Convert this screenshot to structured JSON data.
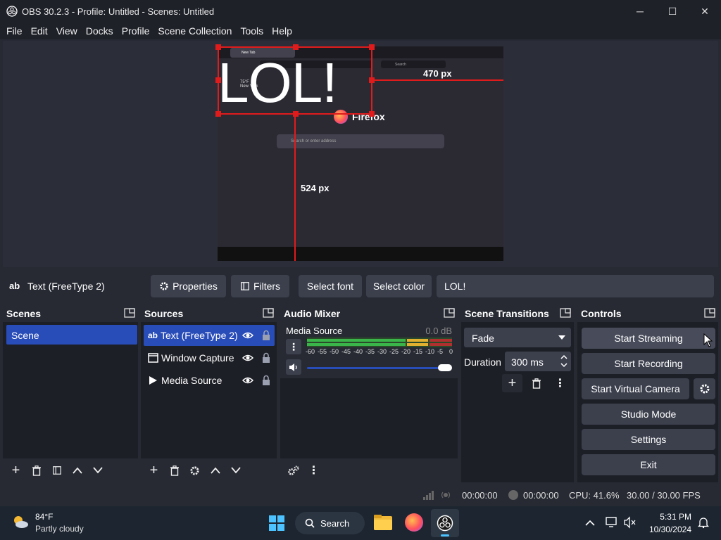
{
  "window": {
    "title": "OBS 30.2.3 - Profile: Untitled - Scenes: Untitled",
    "minimize": "─",
    "maximize": "☐",
    "close": "✕"
  },
  "menu": [
    "File",
    "Edit",
    "View",
    "Docks",
    "Profile",
    "Scene Collection",
    "Tools",
    "Help"
  ],
  "preview": {
    "text_source_content": "LOL!",
    "measure_right": "470 px",
    "measure_bottom": "524 px",
    "browser": {
      "tab_label": "New Tab",
      "search_placeholder": "Search",
      "brand": "Firefox",
      "searchbox_placeholder": "Search or enter address",
      "weather_temp": "75°F",
      "weather_city": "New York"
    }
  },
  "properties_bar": {
    "source_icon": "ab",
    "source_name": "Text (FreeType 2)",
    "properties_label": "Properties",
    "filters_label": "Filters",
    "select_font_label": "Select font",
    "select_color_label": "Select color",
    "text_value": "LOL!"
  },
  "scenes": {
    "title": "Scenes",
    "items": [
      "Scene"
    ]
  },
  "sources": {
    "title": "Sources",
    "items": [
      {
        "name": "Text (FreeType 2)",
        "icon": "ab",
        "selected": true
      },
      {
        "name": "Window Capture",
        "icon": "window-icon",
        "selected": false
      },
      {
        "name": "Media Source",
        "icon": "play-icon",
        "selected": false
      }
    ]
  },
  "audio_mixer": {
    "title": "Audio Mixer",
    "channel_name": "Media Source",
    "channel_level": "0.0 dB",
    "ticks": [
      "-60",
      "-55",
      "-50",
      "-45",
      "-40",
      "-35",
      "-30",
      "-25",
      "-20",
      "-15",
      "-10",
      "-5",
      "0"
    ],
    "volume_fraction": 1.0
  },
  "scene_transitions": {
    "title": "Scene Transitions",
    "transition": "Fade",
    "duration_label": "Duration",
    "duration_value": "300 ms"
  },
  "controls": {
    "title": "Controls",
    "start_streaming": "Start Streaming",
    "start_recording": "Start Recording",
    "start_virtual_camera": "Start Virtual Camera",
    "studio_mode": "Studio Mode",
    "settings": "Settings",
    "exit": "Exit"
  },
  "status": {
    "stream_time": "00:00:00",
    "record_time": "00:00:00",
    "cpu": "CPU: 41.6%",
    "fps": "30.00 / 30.00 FPS"
  },
  "taskbar": {
    "weather_temp": "84°F",
    "weather_desc": "Partly cloudy",
    "search_label": "Search",
    "time": "5:31 PM",
    "date": "10/30/2024"
  },
  "colors": {
    "selection_blue": "#284cb8",
    "button_bg": "#3c404d",
    "dock_bg": "#1d1f26",
    "transform_red": "#e01b1b"
  }
}
